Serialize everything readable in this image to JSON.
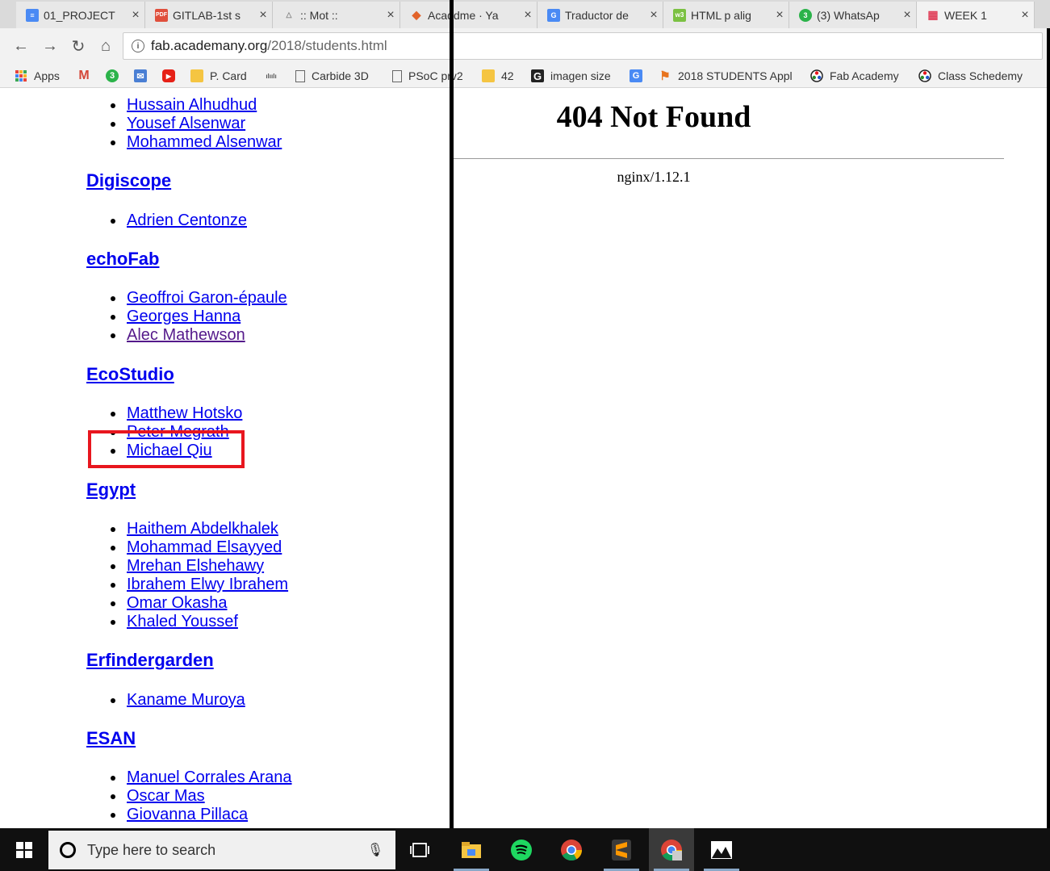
{
  "tabs": [
    {
      "title": "01_PROJECT",
      "color": "#4a8af4",
      "glyph": "≡"
    },
    {
      "title": "GITLAB-1st s",
      "color": "#e04f3c",
      "glyph": "PDF"
    },
    {
      "title": ":: Mot ::",
      "color": "#9a9a9a",
      "glyph": "△"
    },
    {
      "title": "Academe · Ya",
      "color": "#e2632a",
      "glyph": "◆"
    },
    {
      "title": "Traductor de",
      "color": "#4a8af4",
      "glyph": "G"
    },
    {
      "title": "HTML p alig",
      "color": "#7bc142",
      "glyph": "w3"
    },
    {
      "title": "(3) WhatsAp",
      "color": "#2bb34a",
      "glyph": "3"
    },
    {
      "title": "WEEK 1",
      "color": "#e0405a",
      "glyph": "▦"
    }
  ],
  "address": {
    "domain": "fab.academany.org",
    "path": "/2018/students.html"
  },
  "bookmarks": [
    {
      "label": "Apps",
      "icon": "apps-icon"
    },
    {
      "label": "",
      "icon": "gmail-icon"
    },
    {
      "label": "",
      "icon": "whatsapp-icon"
    },
    {
      "label": "",
      "icon": "mail-icon"
    },
    {
      "label": "",
      "icon": "youtube-icon"
    },
    {
      "label": "P. Card",
      "icon": "folder-icon"
    },
    {
      "label": "",
      "icon": "cisco-icon"
    },
    {
      "label": "Carbide 3D",
      "icon": "page-icon"
    },
    {
      "label": "PSoC prv2",
      "icon": "page-icon"
    },
    {
      "label": "42",
      "icon": "folder-icon"
    },
    {
      "label": "imagen size",
      "icon": "g-icon"
    },
    {
      "label": "",
      "icon": "translate-icon"
    },
    {
      "label": "2018 STUDENTS Appl",
      "icon": "flag-icon"
    },
    {
      "label": "Fab Academy",
      "icon": "fab-icon"
    },
    {
      "label": "Class Schedemy",
      "icon": "fab-icon"
    }
  ],
  "groups": [
    {
      "name": "",
      "students": [
        "Hussain Alhudhud",
        "Yousef Alsenwar",
        "Mohammed Alsenwar"
      ]
    },
    {
      "name": "Digiscope",
      "students": [
        "Adrien Centonze"
      ]
    },
    {
      "name": "echoFab",
      "students": [
        "Geoffroi Garon-épaule",
        "Georges Hanna",
        "Alec Mathewson"
      ]
    },
    {
      "name": "EcoStudio",
      "students": [
        "Matthew Hotsko",
        "Peter Megrath",
        "Michael Qiu"
      ]
    },
    {
      "name": "Egypt",
      "students": [
        "Haithem Abdelkhalek",
        "Mohammad Elsayyed",
        "Mrehan Elshehawy",
        "Ibrahem Elwy Ibrahem",
        "Omar Okasha",
        "Khaled Youssef"
      ]
    },
    {
      "name": "Erfindergarden",
      "students": [
        "Kaname Muroya"
      ]
    },
    {
      "name": "ESAN",
      "students": [
        "Manuel Corrales Arana",
        "Oscar Mas",
        "Giovanna Pillaca"
      ]
    }
  ],
  "error_page": {
    "title": "404 Not Found",
    "server": "nginx/1.12.1"
  },
  "taskbar": {
    "search_placeholder": "Type here to search",
    "apps": [
      "task-view-icon",
      "file-explorer-icon",
      "spotify-icon",
      "chrome-icon",
      "sublime-icon",
      "chrome-profile-icon",
      "photos-icon"
    ]
  },
  "colors": {
    "link": "#0000ee",
    "visited": "#551a8b",
    "highlight": "#e8161e"
  }
}
